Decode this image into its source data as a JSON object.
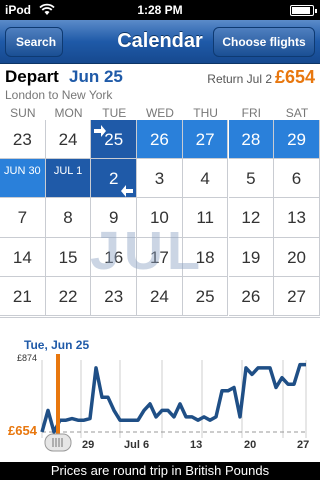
{
  "status": {
    "carrier": "iPod",
    "time": "1:28 PM"
  },
  "nav": {
    "back_label": "Search",
    "title": "Calendar",
    "action_label": "Choose flights"
  },
  "trip": {
    "depart_label": "Depart",
    "depart_date": "Jun 25",
    "route": "London to New York",
    "return_label": "Return Jul 2",
    "price": "£654"
  },
  "calendar": {
    "weekdays": [
      "SUN",
      "MON",
      "TUE",
      "WED",
      "THU",
      "FRI",
      "SAT"
    ],
    "month_watermark": "JUL",
    "rows": [
      [
        "23",
        "24",
        "25",
        "26",
        "27",
        "28",
        "29"
      ],
      [
        "JUN 30",
        "JUL 1",
        "2",
        "3",
        "4",
        "5",
        "6"
      ],
      [
        "7",
        "8",
        "9",
        "10",
        "11",
        "12",
        "13"
      ],
      [
        "14",
        "15",
        "16",
        "17",
        "18",
        "19",
        "20"
      ],
      [
        "21",
        "22",
        "23",
        "24",
        "25",
        "26",
        "27"
      ]
    ]
  },
  "chart": {
    "title": "Tue, Jun 25",
    "ymax_label": "£874",
    "ymin_label": "£654",
    "footer": "Prices are round trip in British Pounds",
    "x_ticks": [
      "29",
      "Jul 6",
      "13",
      "20",
      "27"
    ]
  },
  "chart_data": {
    "type": "line",
    "series": [
      {
        "values": [
          654,
          720,
          654,
          690,
          690,
          695,
          690,
          690,
          695,
          850,
          760,
          760,
          720,
          690,
          690,
          690,
          690,
          720,
          740,
          700,
          720,
          720,
          700,
          740,
          700,
          700,
          690,
          700,
          690,
          700,
          780,
          780,
          790,
          700,
          850,
          830,
          850,
          850,
          850,
          790,
          820,
          800,
          800,
          860,
          860
        ]
      }
    ],
    "ylim": [
      654,
      874
    ],
    "accent": "#1f4f86",
    "marker_color": "#e8770e"
  }
}
